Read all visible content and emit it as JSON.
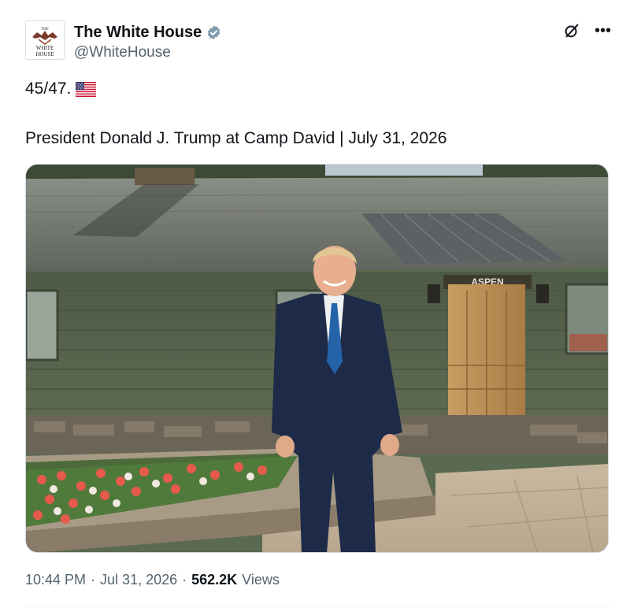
{
  "post": {
    "author": {
      "display_name": "The White House",
      "handle": "@WhiteHouse",
      "verified": true,
      "avatar_text": "THE WHITE HOUSE",
      "verified_color": "#829aab"
    },
    "icons": {
      "grok": "grok-icon",
      "more": "more-icon",
      "verified": "verified-badge-icon",
      "flag": "us-flag-icon"
    },
    "text_line1": "45/47.",
    "text_line2": "President Donald J. Trump at Camp David | July 31, 2026",
    "media": {
      "sign_text": "ASPEN"
    },
    "meta": {
      "time": "10:44 PM",
      "date": "Jul 31, 2026",
      "views_count": "562.2K",
      "views_label": "Views",
      "sep": "·"
    }
  }
}
